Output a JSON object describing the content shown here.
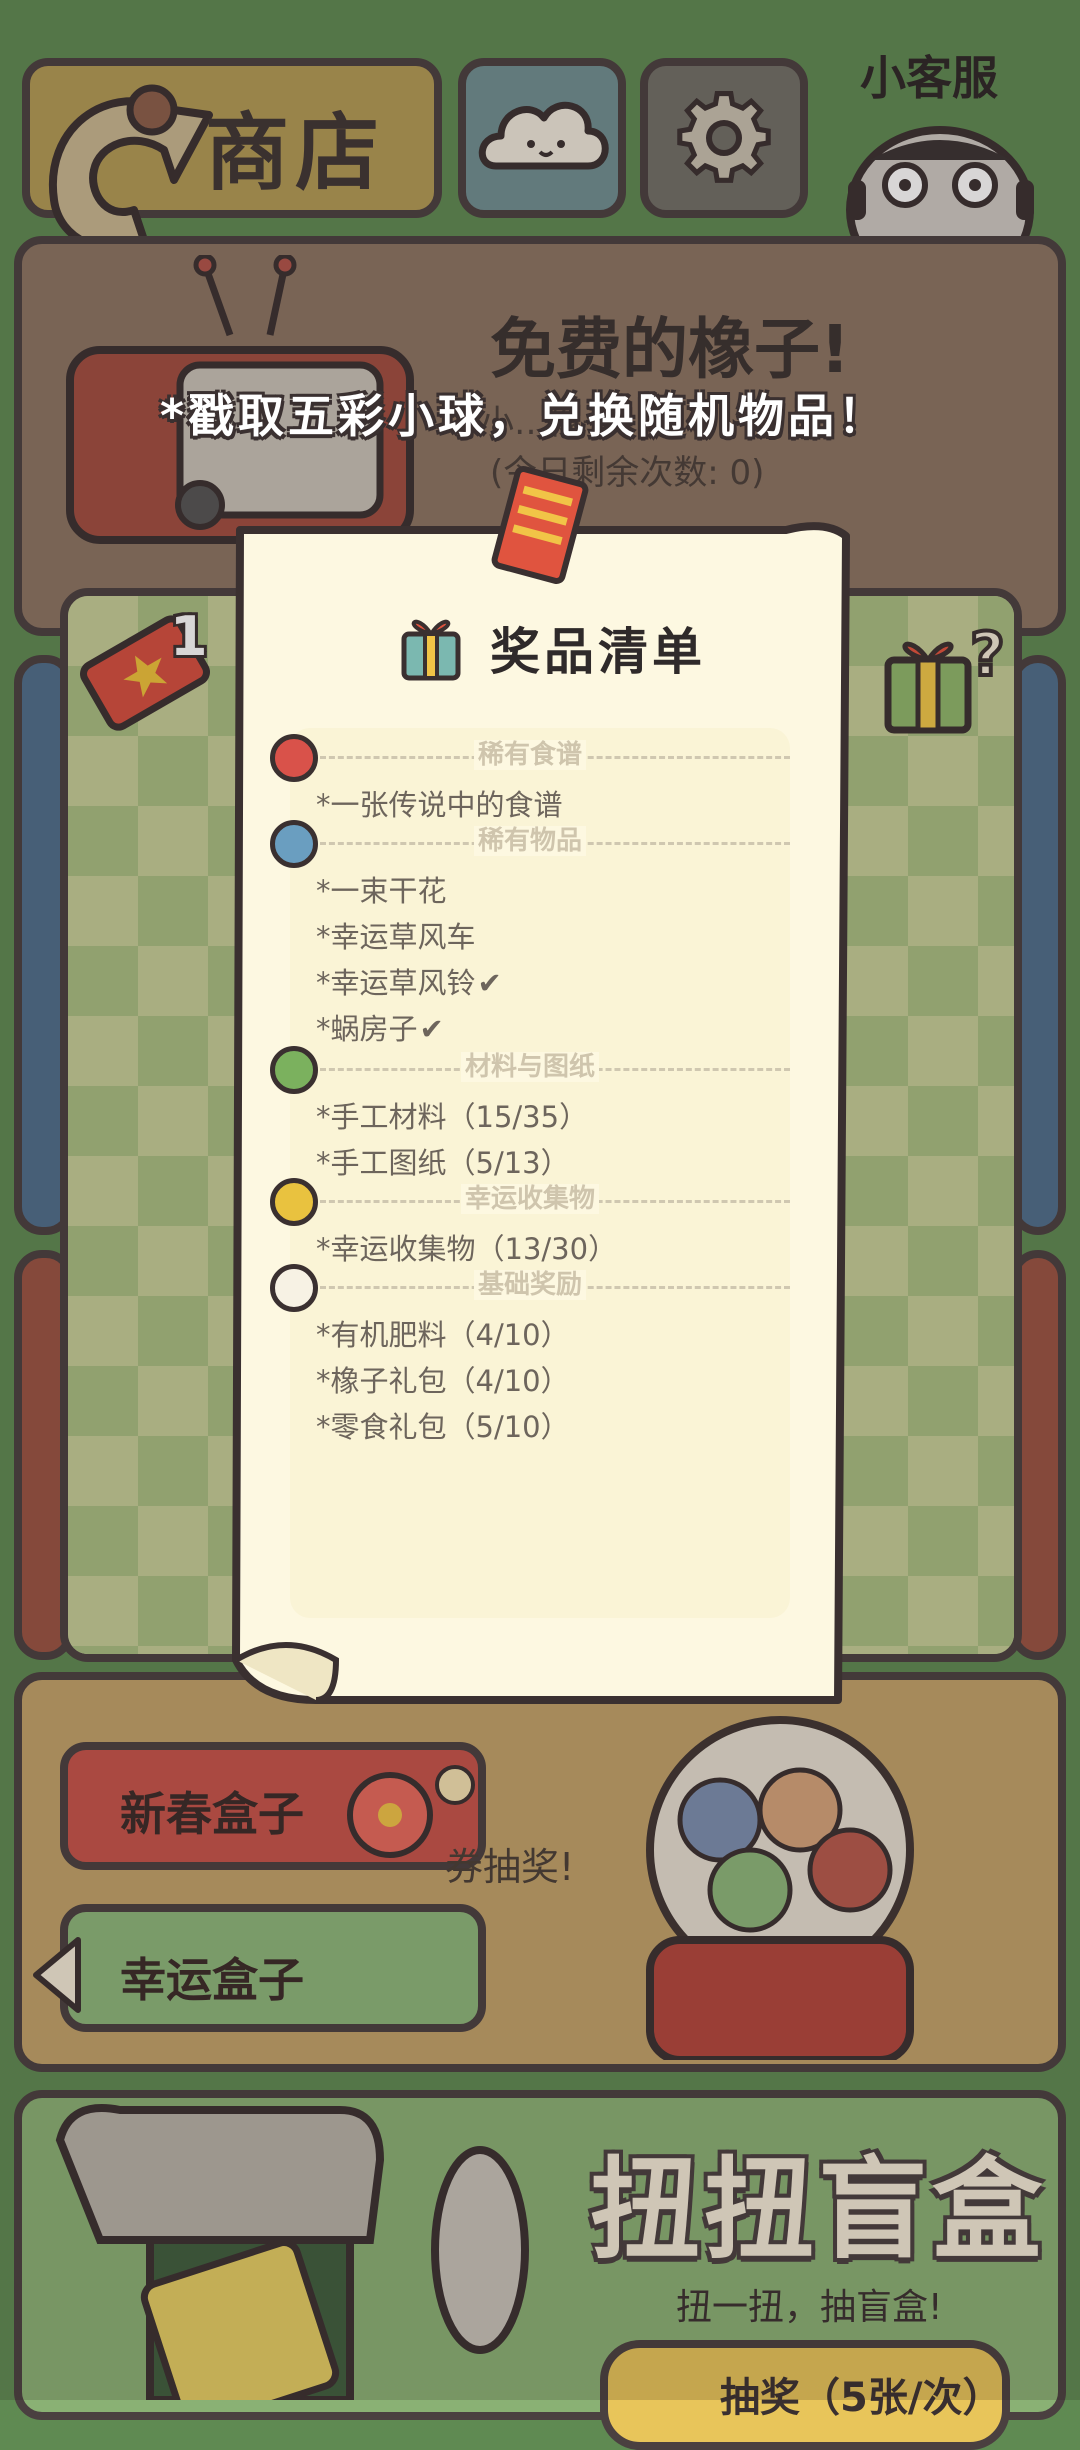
{
  "top_bar": {
    "shop_label": "商店",
    "service_label": "小客服"
  },
  "free_acorn": {
    "title": "免费的橡子!",
    "description_partial": "小…橡子",
    "remaining_partial": "(今日剩余次数: 0)"
  },
  "banner": "*戳取五彩小球，兑换随机物品！",
  "ticket_count": "1",
  "prize_list": {
    "heading": "奖品清单",
    "sections": [
      {
        "name": "稀有食谱",
        "color": "#d9524a",
        "items": [
          {
            "text": "*一张传说中的食谱",
            "checked": false
          }
        ]
      },
      {
        "name": "稀有物品",
        "color": "#6a9ec0",
        "items": [
          {
            "text": "*一束干花",
            "checked": false
          },
          {
            "text": "*幸运草风车",
            "checked": false
          },
          {
            "text": "*幸运草风铃",
            "checked": true
          },
          {
            "text": "*蜗房子",
            "checked": true
          }
        ]
      },
      {
        "name": "材料与图纸",
        "color": "#7bb15e",
        "items": [
          {
            "text": "*手工材料（15/35）",
            "checked": false
          },
          {
            "text": "*手工图纸（5/13）",
            "checked": false
          }
        ]
      },
      {
        "name": "幸运收集物",
        "color": "#e9c23f",
        "items": [
          {
            "text": "*幸运收集物（13/30）",
            "checked": false
          }
        ]
      },
      {
        "name": "基础奖励",
        "color": "#f7f2e4",
        "items": [
          {
            "text": "*有机肥料（4/10）",
            "checked": false
          },
          {
            "text": "*橡子礼包（4/10）",
            "checked": false
          },
          {
            "text": "*零食礼包（5/10）",
            "checked": false
          }
        ]
      }
    ]
  },
  "box_section": {
    "newyear_label": "新春盒子",
    "lucky_label": "幸运盒子",
    "hint_partial": "券抽奖!"
  },
  "gacha": {
    "title": "扭扭盲盒",
    "subtitle": "扭一扭，抽盲盒!",
    "draw_label": "抽奖（5张/次）"
  }
}
